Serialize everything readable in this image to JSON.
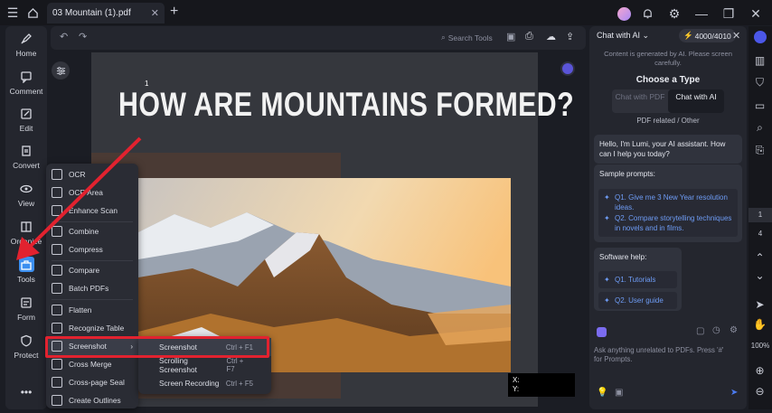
{
  "tab": {
    "title": "03 Mountain (1).pdf"
  },
  "toolbar": {
    "search_tools": "Search Tools"
  },
  "nav": [
    {
      "label": "Home",
      "icon": "rocket-icon"
    },
    {
      "label": "Comment",
      "icon": "comment-icon"
    },
    {
      "label": "Edit",
      "icon": "edit-icon"
    },
    {
      "label": "Convert",
      "icon": "convert-icon"
    },
    {
      "label": "View",
      "icon": "eye-icon"
    },
    {
      "label": "Organize",
      "icon": "organize-icon"
    },
    {
      "label": "Tools",
      "icon": "toolbox-icon"
    },
    {
      "label": "Form",
      "icon": "form-icon"
    },
    {
      "label": "Protect",
      "icon": "shield-icon"
    }
  ],
  "document": {
    "page_number": "1",
    "heading": "HOW ARE MOUNTAINS FORMED?",
    "coord_x": "X:",
    "coord_y": "Y:"
  },
  "menu": [
    {
      "label": "OCR"
    },
    {
      "label": "OCR Area"
    },
    {
      "label": "Enhance Scan"
    },
    {
      "label": "Combine"
    },
    {
      "label": "Compress"
    },
    {
      "label": "Compare"
    },
    {
      "label": "Batch PDFs"
    },
    {
      "label": "Flatten"
    },
    {
      "label": "Recognize Table"
    },
    {
      "label": "Screenshot"
    },
    {
      "label": "Cross Merge"
    },
    {
      "label": "Cross-page Seal"
    },
    {
      "label": "Create Outlines"
    }
  ],
  "submenu": [
    {
      "label": "Screenshot",
      "shortcut": "Ctrl + F1"
    },
    {
      "label": "Scrolling Screenshot",
      "shortcut": "Ctrl + F7"
    },
    {
      "label": "Screen Recording",
      "shortcut": "Ctrl + F5"
    }
  ],
  "ai": {
    "title": "Chat with AI",
    "credits": "4000/4010",
    "notice": "Content is generated by AI. Please screen carefully.",
    "choose_type": "Choose a Type",
    "option_pdf": "Chat with PDF",
    "option_ai": "Chat with AI",
    "pdf_related": "PDF related / Other",
    "greeting": "Hello, I'm Lumi, your AI assistant. How can I help you today?",
    "sample_title": "Sample prompts:",
    "sample_prompts": [
      "Q1. Give me 3 New Year resolution ideas.",
      "Q2. Compare storytelling techniques in novels and in films."
    ],
    "software_title": "Software help:",
    "software_prompts": [
      "Q1. Tutorials",
      "Q2. User guide"
    ],
    "input_placeholder": "Ask anything unrelated to PDFs. Press '#' for Prompts."
  },
  "rail": {
    "page_current": "1",
    "page_total": "4",
    "zoom": "100%"
  },
  "colors": {
    "accent_red": "#e2222f",
    "link_blue": "#6e9cf5",
    "brand_purple": "#7b6cf0"
  }
}
